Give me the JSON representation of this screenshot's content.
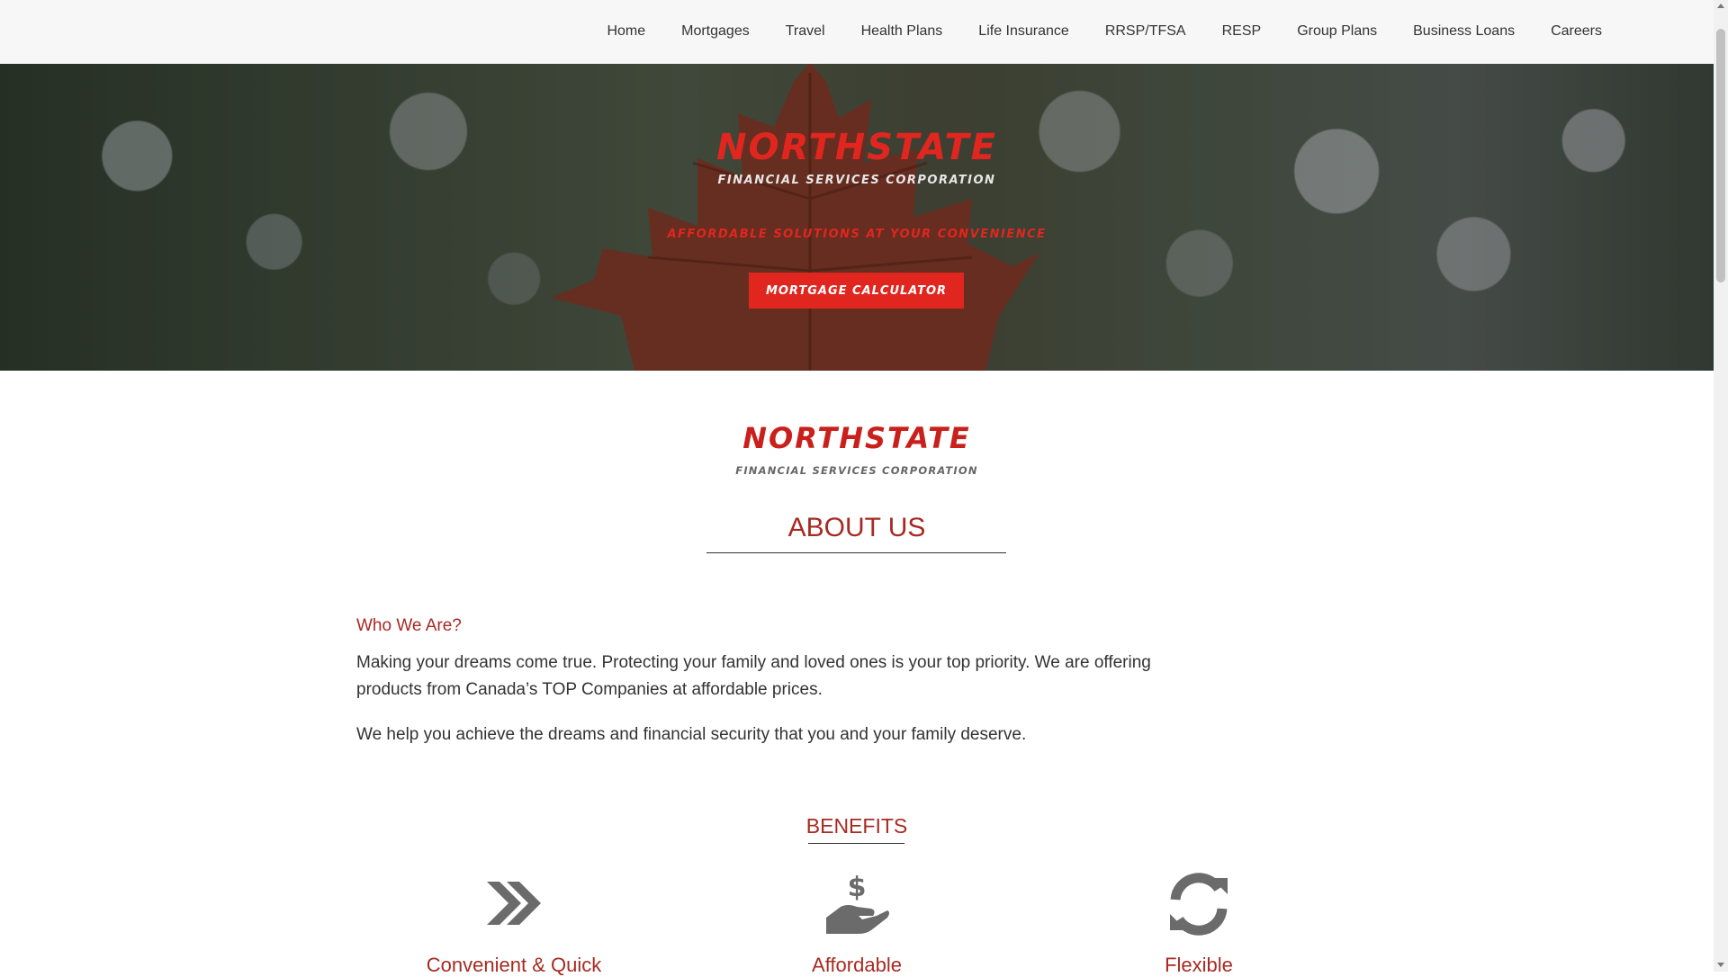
{
  "nav": {
    "items": [
      {
        "label": "Home"
      },
      {
        "label": "Mortgages"
      },
      {
        "label": "Travel"
      },
      {
        "label": "Health Plans"
      },
      {
        "label": "Life Insurance"
      },
      {
        "label": "RRSP/TFSA"
      },
      {
        "label": "RESP"
      },
      {
        "label": "Group Plans"
      },
      {
        "label": "Business Loans"
      },
      {
        "label": "Careers"
      }
    ]
  },
  "hero": {
    "title": "NORTHSTATE",
    "subtitle": "FINANCIAL SERVICES CORPORATION",
    "tagline": "AFFORDABLE SOLUTIONS AT YOUR CONVENIENCE",
    "button_label": "MORTGAGE CALCULATOR"
  },
  "logo": {
    "word": "NORTHSTATE",
    "sub": "FINANCIAL SERVICES CORPORATION"
  },
  "about": {
    "title": "ABOUT US",
    "who_title": "Who We Are?",
    "paragraph1": "Making your dreams come true. Protecting your family and loved ones is your top priority. We are offering products from Canada’s TOP Companies at affordable prices.",
    "paragraph2": "We help you achieve the dreams and financial security that you and your family deserve."
  },
  "benefits": {
    "title": "BENEFITS",
    "items": [
      {
        "label": "Convenient & Quick",
        "icon": "double-chevron-right-icon"
      },
      {
        "label": "Affordable",
        "icon": "dollar-hand-icon"
      },
      {
        "label": "Flexible",
        "icon": "refresh-icon"
      }
    ]
  },
  "colors": {
    "brand_red": "#e0261f",
    "heading_red": "#a72a22",
    "icon_gray": "#6b6b6b"
  }
}
